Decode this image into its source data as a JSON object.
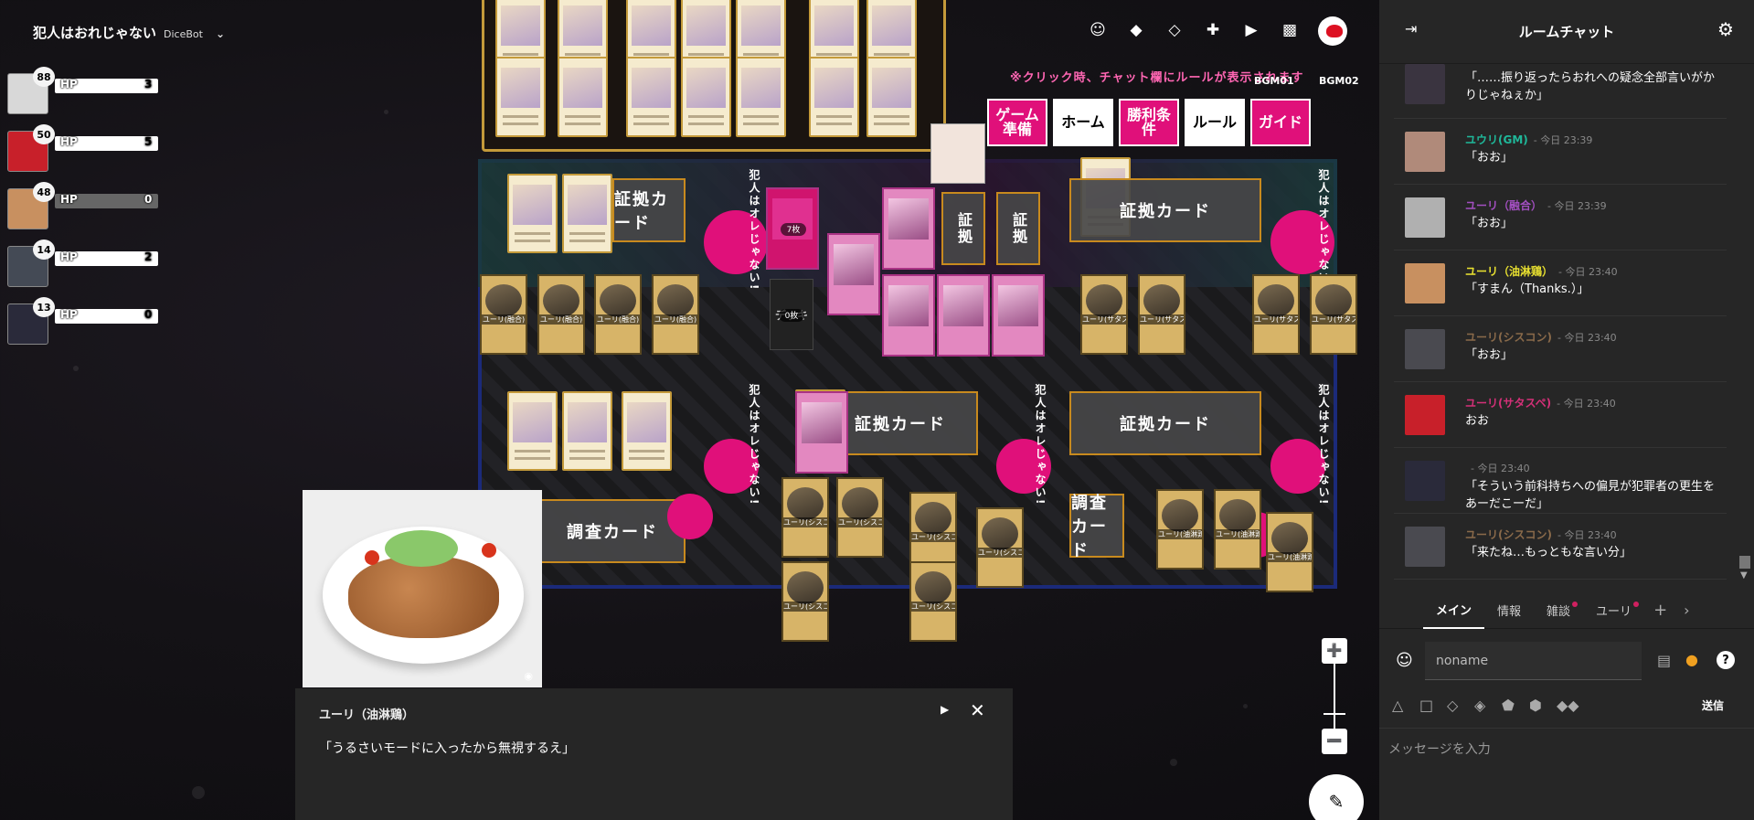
{
  "room": {
    "title": "犯人はおれじゃない",
    "system": "DiceBot"
  },
  "players": [
    {
      "badge": "88",
      "hp_label": "HP",
      "hp_value": "3",
      "hp_fill": 1.0,
      "color": "#d8d8d8"
    },
    {
      "badge": "50",
      "hp_label": "HP",
      "hp_value": "5",
      "hp_fill": 1.0,
      "color": "#c8202a"
    },
    {
      "badge": "48",
      "hp_label": "HP",
      "hp_value": "0",
      "hp_fill": 0.0,
      "color": "#c89060"
    },
    {
      "badge": "14",
      "hp_label": "HP",
      "hp_value": "2",
      "hp_fill": 1.0,
      "color": "#444a55"
    },
    {
      "badge": "13",
      "hp_label": "HP",
      "hp_value": "0",
      "hp_fill": 1.0,
      "color": "#2a2a3a"
    }
  ],
  "toolbar": [
    "face-icon",
    "layers-icon",
    "layers-outline-icon",
    "add-comment-icon",
    "video-icon",
    "movie-icon"
  ],
  "board": {
    "hint": "※クリック時、チャット欄にルールが表示されます",
    "bgm1": "BGM01",
    "bgm2": "BGM02",
    "logos": [
      "ゲーム準備",
      "ホーム",
      "勝利条件",
      "ルール",
      "ガイド"
    ],
    "vertical_text": "犯人はオレじゃない!",
    "evidence_card": "証拠カード",
    "investigation_card": "調査カード",
    "evidence_short": "証拠",
    "deck_label": "デッキ",
    "deck_count": "0枚",
    "pink_count": "7枚",
    "card_names": [
      "ユーリ(融合)",
      "ユーリ(融合)",
      "ユーリ(融合)",
      "ユーリ(融合)",
      "ユーリ(サタスペ)",
      "ユーリ(サタスペ)",
      "ユーリ(サタスペ)",
      "ユーリ(サタスペ)",
      "ユーリ(シスコン)",
      "ユーリ(シスコン)",
      "ユーリ(シスコン)",
      "ユーリ(シスコン)",
      "ユーリ(シスコン)",
      "ユーリ(シスコン)",
      "ユーリ(油淋鶏)",
      "ユーリ(油淋鶏)",
      "ユーリ(油淋鶏)"
    ]
  },
  "speech": {
    "name": "ユーリ（油淋鶏）",
    "text": "「うるさいモードに入ったから無視するえ」"
  },
  "chat": {
    "title": "ルームチャット",
    "messages": [
      {
        "who": "",
        "time": "",
        "body": "「……振り返ったらおれへの疑念全部言いがかりじゃねぇか」",
        "color": "#ffffff",
        "avatar": "#3a3440"
      },
      {
        "who": "ユウリ(GM)",
        "time": "- 今日 23:39",
        "body": "「おお」",
        "color": "#1fb89a",
        "avatar": "#b08a7a"
      },
      {
        "who": "ユーリ（融合）",
        "time": "- 今日 23:39",
        "body": "「おお」",
        "color": "#a24fc0",
        "avatar": "#b0b0b0"
      },
      {
        "who": "ユーリ（油淋鶏）",
        "time": "- 今日 23:40",
        "body": "「すまん（Thanks.）」",
        "color": "#e8e030",
        "avatar": "#c89060"
      },
      {
        "who": "ユーリ(シスコン)",
        "time": "- 今日 23:40",
        "body": "「おお」",
        "color": "#8a6a4a",
        "avatar": "#4a4a50"
      },
      {
        "who": "ユーリ(サタスペ)",
        "time": "- 今日 23:40",
        "body": "おお",
        "color": "#d43078",
        "avatar": "#c8202a"
      },
      {
        "who": "",
        "time": "- 今日 23:40",
        "body": "「そういう前科持ちへの偏見が犯罪者の更生をあーだこーだ」",
        "color": "#ffffff",
        "avatar": "#2a2a3a"
      },
      {
        "who": "ユーリ(シスコン)",
        "time": "- 今日 23:40",
        "body": "「来たね…もっともな言い分」",
        "color": "#8a6a4a",
        "avatar": "#4a4a50"
      }
    ],
    "tabs": [
      {
        "label": "メイン",
        "active": true,
        "badge": false
      },
      {
        "label": "情報",
        "active": false,
        "badge": false
      },
      {
        "label": "雑談",
        "active": false,
        "badge": true
      },
      {
        "label": "ユーリ",
        "active": false,
        "badge": true
      }
    ],
    "name_placeholder": "noname",
    "send_label": "送信",
    "message_placeholder": "メッセージを入力"
  }
}
